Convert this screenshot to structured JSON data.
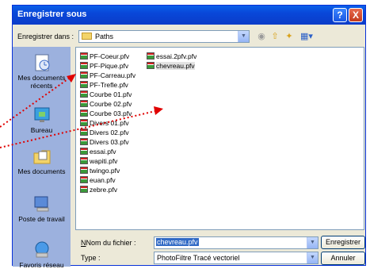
{
  "title": "Enregistrer sous",
  "save_in": {
    "label": "Enregistrer dans :",
    "folder": "Paths"
  },
  "toolbar": {
    "back_icon": "back-icon",
    "up_icon": "up-folder-icon",
    "new_folder_icon": "new-folder-icon",
    "view_icon": "view-menu-icon"
  },
  "places": [
    {
      "label": "Mes documents récents",
      "icon": "recent-documents-icon"
    },
    {
      "label": "Bureau",
      "icon": "desktop-icon"
    },
    {
      "label": "Mes documents",
      "icon": "my-documents-icon"
    },
    {
      "label": "Poste de travail",
      "icon": "my-computer-icon"
    },
    {
      "label": "Favoris réseau",
      "icon": "network-icon"
    }
  ],
  "files_col1": [
    "PF-Coeur.pfv",
    "PF-Pique.pfv",
    "PF-Carreau.pfv",
    "PF-Trefle.pfv",
    "Courbe 01.pfv",
    "Courbe 02.pfv",
    "Courbe 03.pfv",
    "Divers 01.pfv",
    "Divers 02.pfv",
    "Divers 03.pfv",
    "essai.pfv",
    "wapiti.pfv",
    "twingo.pfv",
    "euan.pfv",
    "zebre.pfv"
  ],
  "files_col2": [
    "essai.2pfv.pfv",
    "chevreau.pfv"
  ],
  "filename": {
    "label": "Nom du fichier :",
    "value": "chevreau.pfv"
  },
  "filetype": {
    "label": "Type :",
    "value": "PhotoFiltre Tracé vectoriel"
  },
  "buttons": {
    "save": "Enregistrer",
    "cancel": "Annuler"
  },
  "title_buttons": {
    "help": "?",
    "close": "X"
  }
}
